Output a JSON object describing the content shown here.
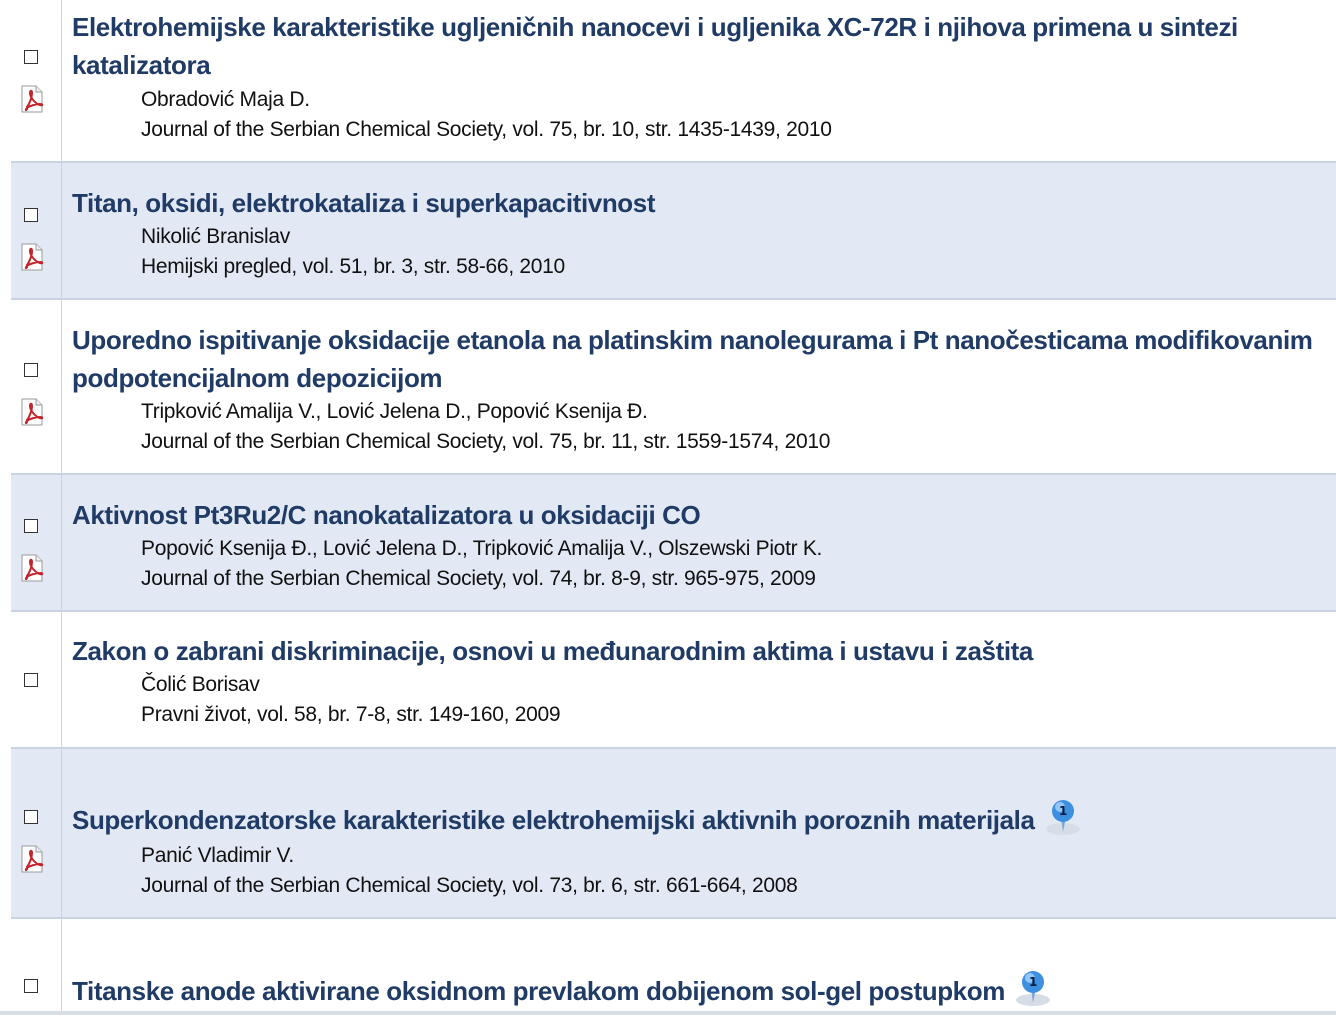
{
  "results": [
    {
      "title": "Elektrohemijske karakteristike ugljeničnih nanocevi i ugljenika XC-72R i njihova primena u sintezi katalizatora",
      "authors": "Obradović Maja D.",
      "source": "Journal of the Serbian Chemical Society, vol. 75, br. 10, str. 1435-1439, 2010",
      "has_pdf": true
    },
    {
      "title": "Titan, oksidi, elektrokataliza i superkapacitivnost",
      "authors": "Nikolić Branislav",
      "source": "Hemijski pregled, vol. 51, br. 3, str. 58-66, 2010",
      "has_pdf": true
    },
    {
      "title": "Uporedno ispitivanje oksidacije etanola na platinskim nanolegurama i Pt nanočesticama modifikovanim podpotencijalnom depozicijom",
      "authors": "Tripković Amalija V., Lović Jelena D., Popović Ksenija Đ.",
      "source": "Journal of the Serbian Chemical Society, vol. 75, br. 11, str. 1559-1574, 2010",
      "has_pdf": true
    },
    {
      "title": "Aktivnost Pt3Ru2/C nanokatalizatora u oksidaciji CO",
      "authors": "Popović Ksenija Đ., Lović Jelena D., Tripković Amalija V., Olszewski Piotr K.",
      "source": "Journal of the Serbian Chemical Society, vol. 74, br. 8-9, str. 965-975, 2009",
      "has_pdf": true
    },
    {
      "title": "Zakon o zabrani diskriminacije, osnovi u međunarodnim aktima i ustavu i zaštita",
      "authors": "Čolić Borisav",
      "source": "Pravni život, vol. 58, br. 7-8, str. 149-160, 2009",
      "has_pdf": false
    },
    {
      "title": "Superkondenzatorske karakteristike elektrohemijski aktivnih poroznih materijala",
      "authors": "Panić Vladimir V.",
      "source": "Journal of the Serbian Chemical Society, vol. 73, br. 6, str. 661-664, 2008",
      "has_pdf": true,
      "citations": "1"
    },
    {
      "title": "Titanske anode aktivirane oksidnom prevlakom dobijenom sol-gel postupkom",
      "has_pdf": false,
      "citations": "1"
    }
  ],
  "colors": {
    "title": "#1f3b66",
    "alt_row": "#e3e9f4",
    "border": "#c9d3e2",
    "pdf_red": "#c4242b",
    "badge_blue": "#3d8fe0"
  },
  "icons": {
    "checkbox": "checkbox-icon",
    "pdf": "pdf-icon",
    "citation": "citation-badge-icon"
  }
}
